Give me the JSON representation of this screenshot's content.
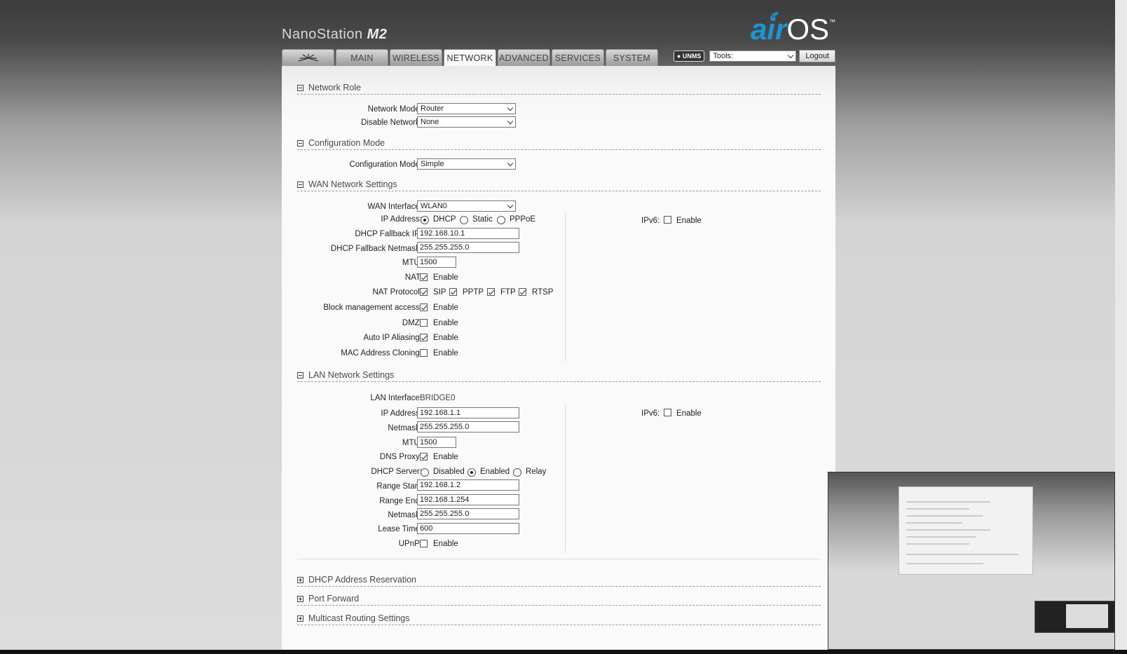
{
  "header": {
    "brand_name": "NanoStation",
    "brand_model": "M2",
    "logo_air": "air",
    "logo_os": "OS",
    "logo_tm": "™"
  },
  "tabs": [
    {
      "label": "",
      "icon": "ubiquiti-logo-icon"
    },
    {
      "label": "MAIN"
    },
    {
      "label": "WIRELESS"
    },
    {
      "label": "NETWORK",
      "active": true
    },
    {
      "label": "ADVANCED"
    },
    {
      "label": "SERVICES"
    },
    {
      "label": "SYSTEM"
    }
  ],
  "toolbar": {
    "unms_label": "UNMS",
    "tools_value": "Tools:",
    "logout_label": "Logout"
  },
  "sections": {
    "network_role": "Network Role",
    "configuration_mode": "Configuration Mode",
    "wan_settings": "WAN Network Settings",
    "lan_settings": "LAN Network Settings",
    "dhcp_reservation": "DHCP Address Reservation",
    "port_forward": "Port Forward",
    "multicast": "Multicast Routing Settings"
  },
  "network_role": {
    "network_mode_label": "Network Mode:",
    "network_mode_value": "Router",
    "disable_network_label": "Disable Network:",
    "disable_network_value": "None"
  },
  "configuration_mode": {
    "label": "Configuration Mode:",
    "value": "Simple"
  },
  "wan": {
    "interface_label": "WAN Interface:",
    "interface_value": "WLAN0",
    "ip_address_label": "IP Address:",
    "ip_options": [
      "DHCP",
      "Static",
      "PPPoE"
    ],
    "ip_selected": "DHCP",
    "fallback_ip_label": "DHCP Fallback IP:",
    "fallback_ip_value": "192.168.10.1",
    "fallback_netmask_label": "DHCP Fallback Netmask:",
    "fallback_netmask_value": "255.255.255.0",
    "mtu_label": "MTU:",
    "mtu_value": "1500",
    "nat_label": "NAT:",
    "nat_enable": "Enable",
    "nat_checked": true,
    "nat_protocol_label": "NAT Protocol:",
    "nat_protocols": [
      {
        "name": "SIP",
        "checked": true
      },
      {
        "name": "PPTP",
        "checked": true
      },
      {
        "name": "FTP",
        "checked": true
      },
      {
        "name": "RTSP",
        "checked": true
      }
    ],
    "block_mgmt_label": "Block management access:",
    "block_mgmt_enable": "Enable",
    "block_mgmt_checked": true,
    "dmz_label": "DMZ:",
    "dmz_enable": "Enable",
    "dmz_checked": false,
    "auto_ip_label": "Auto IP Aliasing:",
    "auto_ip_enable": "Enable",
    "auto_ip_checked": true,
    "mac_clone_label": "MAC Address Cloning:",
    "mac_clone_enable": "Enable",
    "mac_clone_checked": false,
    "ipv6_label": "IPv6:",
    "ipv6_enable": "Enable",
    "ipv6_checked": false
  },
  "lan": {
    "interface_label": "LAN Interface:",
    "interface_value": "BRIDGE0",
    "ip_address_label": "IP Address:",
    "ip_address_value": "192.168.1.1",
    "netmask_label": "Netmask:",
    "netmask_value": "255.255.255.0",
    "mtu_label": "MTU:",
    "mtu_value": "1500",
    "dns_proxy_label": "DNS Proxy:",
    "dns_proxy_enable": "Enable",
    "dns_proxy_checked": true,
    "dhcp_server_label": "DHCP Server:",
    "dhcp_server_options": [
      "Disabled",
      "Enabled",
      "Relay"
    ],
    "dhcp_server_selected": "Enabled",
    "range_start_label": "Range Start:",
    "range_start_value": "192.168.1.2",
    "range_end_label": "Range End:",
    "range_end_value": "192.168.1.254",
    "range_netmask_label": "Netmask:",
    "range_netmask_value": "255.255.255.0",
    "lease_time_label": "Lease Time:",
    "lease_time_value": "600",
    "upnp_label": "UPnP:",
    "upnp_enable": "Enable",
    "upnp_checked": false,
    "ipv6_label": "IPv6:",
    "ipv6_enable": "Enable",
    "ipv6_checked": false
  },
  "colors": {
    "accent_blue": "#1a96d6",
    "header_dark": "#3c3c3c",
    "panel_bg": "#fafafa"
  }
}
